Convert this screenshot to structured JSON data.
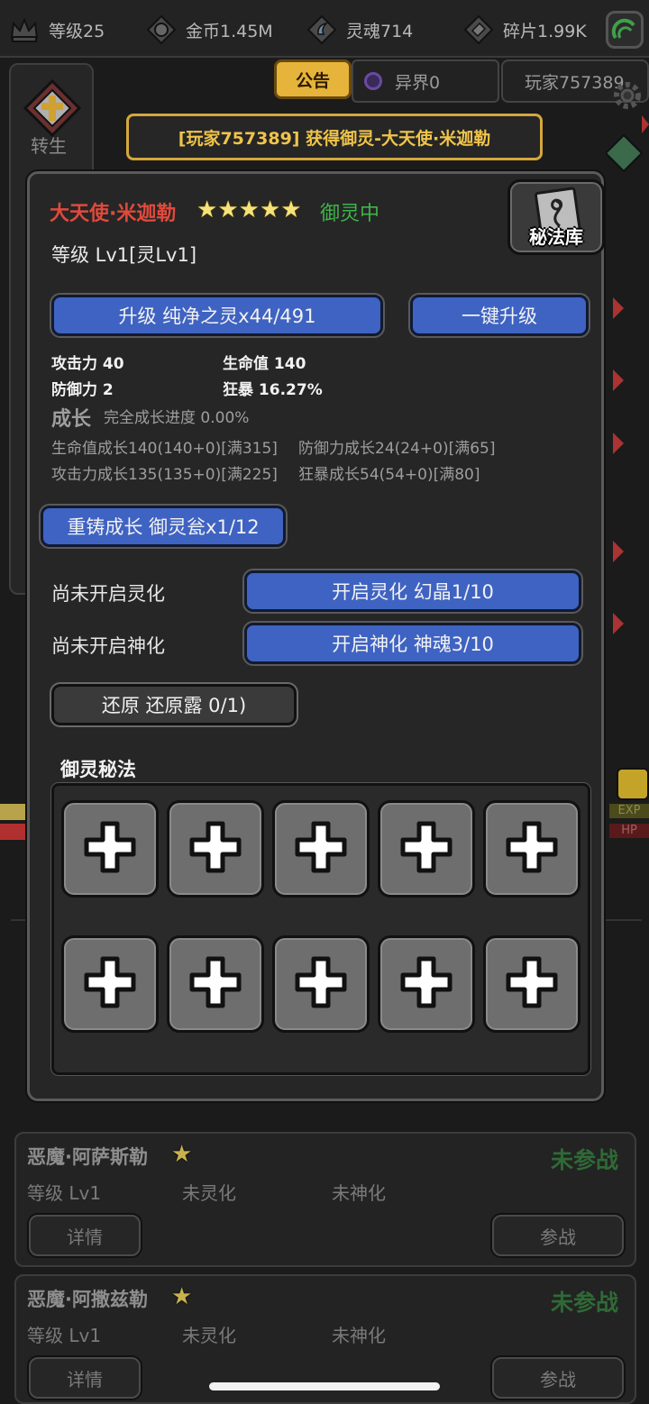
{
  "topbar": {
    "level": "等级25",
    "gold": "金币1.45M",
    "soul": "灵魂714",
    "fragment": "碎片1.99K"
  },
  "background": {
    "notice_tab": "公告",
    "otherworld": "异界0",
    "player": "玩家757389",
    "rebirth": "转生",
    "banner": "[玩家757389] 获得御灵-大天使·米迦勒"
  },
  "hero": {
    "name": "大天使·米迦勒",
    "star_count": 5,
    "star_glyph": "★",
    "status": "御灵中",
    "level": "等级 Lv1[灵Lv1]",
    "library_label": "秘法库",
    "upgrade": "升级 纯净之灵x44/491",
    "upgrade_all": "一键升级",
    "stats": {
      "atk": "攻击力 40",
      "hp": "生命值 140",
      "def": "防御力 2",
      "crit": "狂暴 16.27%"
    },
    "growth": {
      "title": "成长",
      "progress": "完全成长进度 0.00%",
      "hp": "生命值成长140(140+0)[满315]",
      "def": "防御力成长24(24+0)[满65]",
      "atk": "攻击力成长135(135+0)[满225]",
      "crit": "狂暴成长54(54+0)[满80]"
    },
    "recast": "重铸成长 御灵瓮x1/12",
    "ling_status": "尚未开启灵化",
    "ling_btn": "开启灵化 幻晶1/10",
    "shen_status": "尚未开启神化",
    "shen_btn": "开启神化 神魂3/10",
    "restore": "还原 还原露 0/1)",
    "secret_title": "御灵秘法",
    "slot_count": 10
  },
  "list": [
    {
      "name": "恶魔·阿萨斯勒",
      "star": "★",
      "level": "等级 Lv1",
      "ling": "未灵化",
      "shen": "未神化",
      "status": "未参战",
      "detail": "详情",
      "join": "参战"
    },
    {
      "name": "恶魔·阿撒兹勒",
      "star": "★",
      "level": "等级 Lv1",
      "ling": "未灵化",
      "shen": "未神化",
      "status": "未参战",
      "detail": "详情",
      "join": "参战"
    }
  ],
  "colors": {
    "hero_name": "#e04a3c",
    "status_green": "#3fb44a",
    "button_blue": "#3f63c2",
    "banner_gold": "#f0c44a"
  }
}
